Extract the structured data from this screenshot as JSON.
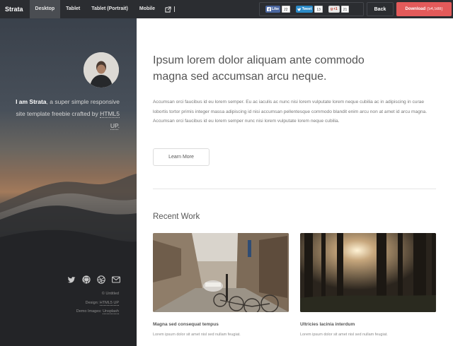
{
  "toolbar": {
    "brand": "Strata",
    "tabs": [
      {
        "label": "Desktop",
        "active": true
      },
      {
        "label": "Tablet",
        "active": false
      },
      {
        "label": "Tablet (Portrait)",
        "active": false
      },
      {
        "label": "Mobile",
        "active": false
      }
    ],
    "social": {
      "facebook": {
        "label": "Like",
        "count": "22"
      },
      "twitter": {
        "label": "Tweet",
        "count": "13"
      },
      "gplus": {
        "label": "+1",
        "count": "21"
      }
    },
    "back_label": "Back",
    "download_label": "Download",
    "download_count": "(54,588)",
    "colors": {
      "bar": "#2b2d31",
      "download": "#e35a5a"
    }
  },
  "sidebar": {
    "intro_strong": "I am Strata",
    "intro_rest": ", a super simple responsive site template freebie crafted by ",
    "intro_link": "HTML5 UP",
    "intro_end": ".",
    "icons": [
      "twitter-icon",
      "github-icon",
      "dribbble-icon",
      "email-icon"
    ],
    "credits": {
      "line1": "© Untitled",
      "design_prefix": "Design: ",
      "design_link": "HTML5 UP",
      "images_prefix": "Demo Images: ",
      "images_link": "Unsplash"
    }
  },
  "main": {
    "headline": "Ipsum lorem dolor aliquam ante commodo magna sed accumsan arcu neque.",
    "body": "Accumsan orci faucibus id eu lorem semper. Eu ac iaculis ac nunc nisi lorem vulputate lorem neque cubilia ac in adipiscing in curae lobortis tortor primis integer massa adipiscing id nisi accumsan pellentesque commodo blandit enim arcu non at amet id arcu magna. Accumsan orci faucibus id eu lorem semper nunc nisi lorem vulputate lorem neque cubilia.",
    "button_label": "Learn More",
    "section_title": "Recent Work",
    "works": [
      {
        "title": "Magna sed consequat tempus",
        "desc": "Lorem ipsum dolor sit amet nisl sed nullam feugiat."
      },
      {
        "title": "Ultricies lacinia interdum",
        "desc": "Lorem ipsum dolor sit amet nisl sed nullam feugiat."
      }
    ]
  }
}
